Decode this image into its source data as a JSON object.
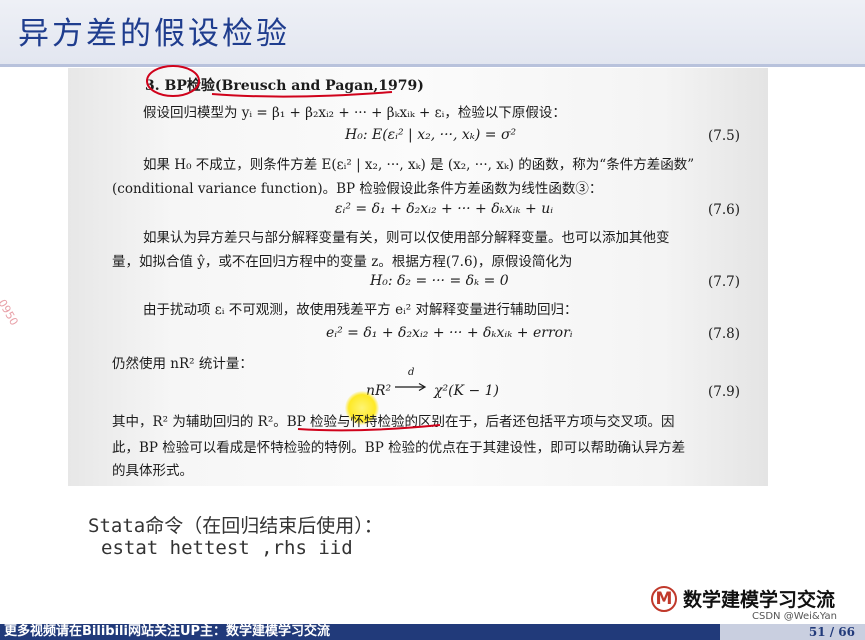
{
  "header": {
    "title": "异方差的假设检验"
  },
  "doc": {
    "heading_num": "3.",
    "heading_bp": "BP",
    "heading_cn": "检验",
    "heading_ref": "(Breusch and Pagan,1979)",
    "lines": {
      "l1": "假设回归模型为 yᵢ = β₁ + β₂xᵢ₂ + ··· + βₖxᵢₖ + εᵢ，检验以下原假设：",
      "eq75": "H₀: E(εᵢ² | x₂, ···, xₖ) = σ²",
      "n75": "(7.5)",
      "l2": "如果 H₀ 不成立，则条件方差 E(εᵢ² | x₂, ···, xₖ) 是 (x₂, ···, xₖ) 的函数，称为“条件方差函数”",
      "l3": "(conditional variance function)。BP 检验假设此条件方差函数为线性函数③：",
      "eq76": "εᵢ² = δ₁ + δ₂xᵢ₂ + ··· + δₖxᵢₖ + uᵢ",
      "n76": "(7.6)",
      "l4": "如果认为异方差只与部分解释变量有关，则可以仅使用部分解释变量。也可以添加其他变",
      "l5": "量，如拟合值 ŷ，或不在回归方程中的变量 z。根据方程(7.6)，原假设简化为",
      "eq77": "H₀: δ₂ = ··· = δₖ = 0",
      "n77": "(7.7)",
      "l6": "由于扰动项 εᵢ 不可观测，故使用残差平方 eᵢ² 对解释变量进行辅助回归：",
      "eq78": "eᵢ² = δ₁ + δ₂xᵢ₂ + ··· + δₖxᵢₖ + errorᵢ",
      "n78": "(7.8)",
      "l7": "仍然使用 nR² 统计量：",
      "eq79a": "nR²",
      "eq79d": "d",
      "eq79b": "χ²(K − 1)",
      "n79": "(7.9)",
      "l8a": "其中，R² 为辅助回归的 R²。",
      "l8b": "BP 检验与怀特检验",
      "l8c": "的区别在于，后者还包括平方项与交叉项。因",
      "l9": "此，BP 检验可以看成是怀特检验的特例。BP 检验的优点在于其建设性，即可以帮助确认异方差",
      "l10": "的具体形式。"
    }
  },
  "stata": {
    "title": "Stata命令（在回归结束后使用）：",
    "command": "estat hettest ,rhs iid"
  },
  "logo": {
    "badge": "M",
    "text": "数学建模学习交流"
  },
  "footer": {
    "text": "更多视频请在Bilibili网站关注UP主：数学建模学习交流",
    "page": "51 / 66"
  },
  "watermark": {
    "csdn": "CSDN @Wei&Yan",
    "side": "0950"
  },
  "colors": {
    "title": "#1f3d8e",
    "footer": "#213a7a",
    "ink": "#d0021b",
    "highlight": "#ffe600"
  }
}
